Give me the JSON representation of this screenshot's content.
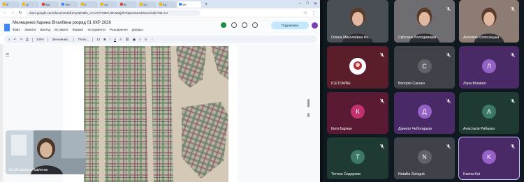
{
  "browser": {
    "tabs": [
      {
        "label": "Ф",
        "color": "#f2b705"
      },
      {
        "label": "Ді",
        "color": "#f2b705"
      },
      {
        "label": "Від",
        "color": "#d9443b"
      },
      {
        "label": "Тел",
        "color": "#4285f4"
      },
      {
        "label": "6",
        "color": "#f2b705"
      },
      {
        "label": "4.р",
        "color": "#f2b705"
      },
      {
        "label": "Ві",
        "color": "#d9443b"
      },
      {
        "label": "4.р",
        "color": "#f2b705"
      },
      {
        "label": "4.р",
        "color": "#f2b705"
      },
      {
        "label": "Ме",
        "color": "#4285f4",
        "active": true
      }
    ],
    "new_tab": "+",
    "url": "docs.google.com/document/d/17qH2Nt6ln_o7178-iFM5FLi9Kw63j8hYbjZxo81nO8szUr/edit?tab=t.0",
    "doc_title": "Мелещенко Карина Віталіївна  розряд  01  ККР 2026",
    "menu": [
      "Файл",
      "Змінити",
      "Вигляд",
      "Вставити",
      "Формат",
      "Інструменти",
      "Розширення",
      "Довідка"
    ],
    "share_label": "Поділитися",
    "toolbar": {
      "zoom": "100%",
      "style": "Звичайний...",
      "font": "Times...",
      "size": "12"
    },
    "self_view_name": "Зоя Віталіївна Павленко"
  },
  "participants": [
    {
      "name": "Олена Миколаївна Фо...",
      "type": "video",
      "muted": false,
      "bg": "#4a4f55"
    },
    {
      "name": "Світлана Володимирів...",
      "type": "video",
      "muted": true,
      "bg": "#6e6e72"
    },
    {
      "name": "Ангеліна Колесніцька",
      "type": "video",
      "muted": true,
      "bg": "#8d7c74"
    },
    {
      "name": "ICETOWNE",
      "type": "image",
      "muted": true,
      "bg": "#5a1e2b",
      "initial": "",
      "avatar_color": "#ffffff"
    },
    {
      "name": "Вікторія Саєнко",
      "type": "avatar",
      "muted": true,
      "bg": "#3f4349",
      "initial": "С",
      "avatar_color": "#5f6368"
    },
    {
      "name": "Лора Біловол",
      "type": "avatar",
      "muted": true,
      "bg": "#4a2a66",
      "initial": "Л",
      "avatar_color": "#9461c7"
    },
    {
      "name": "Катя Барчан",
      "type": "avatar",
      "muted": true,
      "bg": "#5b1a34",
      "initial": "К",
      "avatar_color": "#c2336e"
    },
    {
      "name": "Данило Чеботарьов",
      "type": "avatar",
      "muted": true,
      "bg": "#4a2a66",
      "initial": "Д",
      "avatar_color": "#9461c7"
    },
    {
      "name": "Анастасія Рибалко",
      "type": "avatar",
      "muted": true,
      "bg": "#1f3a33",
      "initial": "А",
      "avatar_color": "#3d7a65"
    },
    {
      "name": "Тетяна Сидорова",
      "type": "avatar",
      "muted": true,
      "bg": "#1f3a33",
      "initial": "Т",
      "avatar_color": "#3d7a65"
    },
    {
      "name": "Natallia Sologub",
      "type": "avatar",
      "muted": true,
      "bg": "#3f4349",
      "initial": "N",
      "avatar_color": "#5f6368"
    },
    {
      "name": "Karina Kot",
      "type": "avatar",
      "muted": true,
      "bg": "#4a2a66",
      "initial": "K",
      "avatar_color": "#9461c7",
      "selected": true
    }
  ]
}
